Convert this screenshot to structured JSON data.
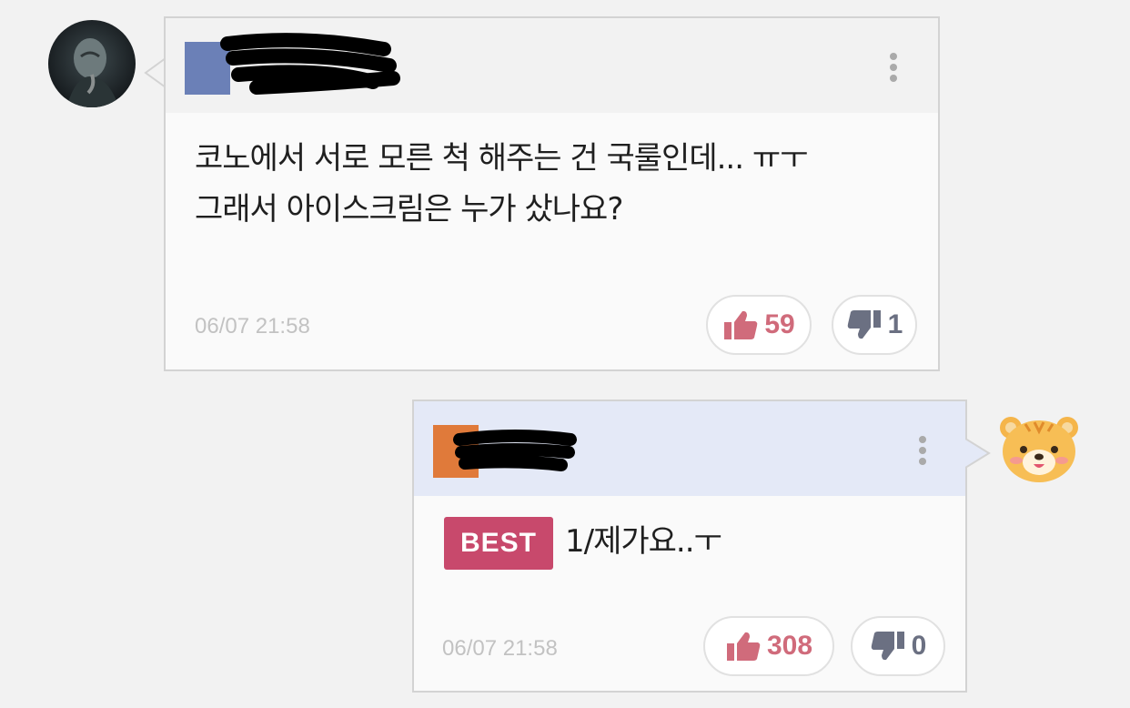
{
  "comments": [
    {
      "text_lines": [
        "코노에서 서로 모른 척 해주는 건 국룰인데... ㅠㅜ",
        "그래서 아이스크림은 누가 샀나요?"
      ],
      "timestamp": "06/07 21:58",
      "likes": "59",
      "dislikes": "1",
      "header_color": "#f2f2f2",
      "badge_color": "#6b80b7"
    },
    {
      "best_label": "BEST",
      "text": "1/제가요..ㅜ",
      "timestamp": "06/07 21:58",
      "likes": "308",
      "dislikes": "0",
      "header_color": "#e4e9f7",
      "badge_color": "#e07a3a"
    }
  ],
  "icons": {
    "like": "thumbs-up-icon",
    "dislike": "thumbs-down-icon",
    "more": "vertical-dots-icon"
  },
  "colors": {
    "like": "#d06b7b",
    "dislike": "#6b7082",
    "best": "#c8496c"
  }
}
